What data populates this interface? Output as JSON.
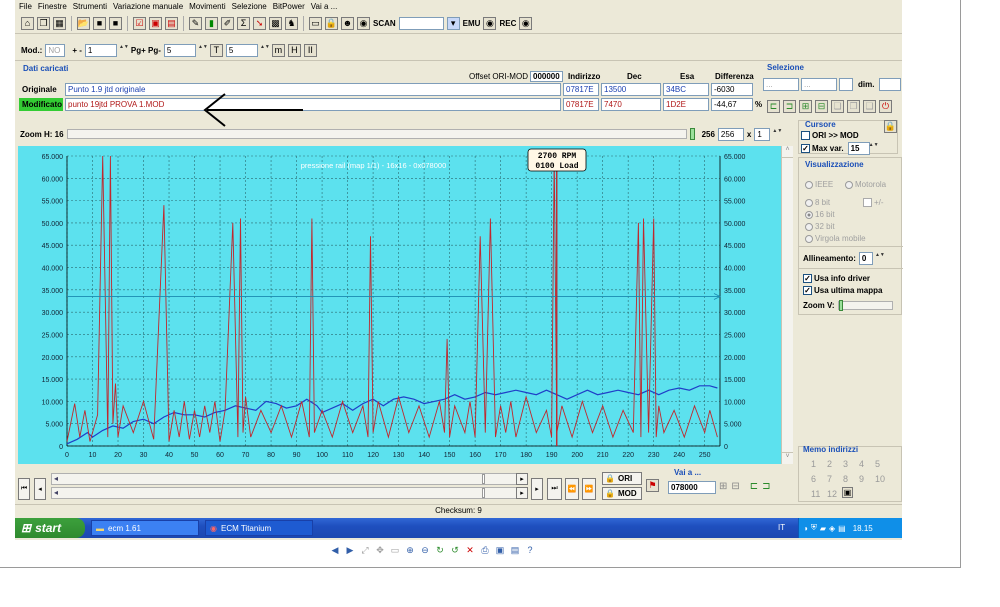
{
  "menu": [
    "File",
    "Finestre",
    "Strumenti",
    "Variazione manuale",
    "Movimenti",
    "Selezione",
    "BitPower",
    "Vai a ..."
  ],
  "toolbar1": {
    "scan_label": "SCAN",
    "emu_label": "EMU",
    "rec_label": "REC"
  },
  "toolbar2": {
    "mod_label": "Mod.:",
    "mod_value": "NO",
    "step_label": "+ -",
    "step_value": "1",
    "pg_label": "Pg+ Pg-",
    "pg_value": "5",
    "t_value": "5"
  },
  "dati": {
    "title": "Dati caricati",
    "offset_label": "Offset ORI-MOD",
    "offset_value": "000000",
    "headers": {
      "indirizzo": "Indirizzo",
      "dec": "Dec",
      "esa": "Esa",
      "differenza": "Differenza"
    },
    "originale": {
      "label": "Originale",
      "file": "Punto 1.9 jtd originale",
      "indirizzo": "07817E",
      "dec": "13500",
      "esa": "34BC",
      "diff": "-6030"
    },
    "modificato": {
      "label": "Modificato",
      "file": "punto 19jtd PROVA 1.MOD",
      "indirizzo": "07817E",
      "dec": "7470",
      "esa": "1D2E",
      "diff": "-44,67",
      "diff_unit": "%"
    }
  },
  "selezione": {
    "title": "Selezione",
    "f1": "...",
    "f2": "...",
    "dim_label": "dim."
  },
  "zoom": {
    "label": "Zoom H: 16",
    "v1": "256",
    "v2": "256",
    "mult": "x",
    "v3": "1"
  },
  "cursore": {
    "title": "Cursore",
    "ori_mod": "ORI >> MOD",
    "maxvar_label": "Max var.",
    "maxvar_value": "15"
  },
  "visualizzazione": {
    "title": "Visualizzazione",
    "ieee": "IEEE",
    "motorola": "Motorola",
    "bit8": "8 bit",
    "plusminus": "+/-",
    "bit16": "16 bit",
    "bit32": "32 bit",
    "virgola": "Virgola mobile",
    "allineamento_label": "Allineamento:",
    "allineamento_value": "0",
    "info_driver": "Usa info driver",
    "ultima_mappa": "Usa ultima mappa",
    "zoomv": "Zoom V:"
  },
  "memo": {
    "title": "Memo indirizzi",
    "items": [
      "1",
      "2",
      "3",
      "4",
      "5",
      "6",
      "7",
      "8",
      "9",
      "10",
      "11",
      "12"
    ]
  },
  "chart": {
    "title": "pressione rail (map 1/1) - 16x16 - 0x078000",
    "tooltip1": "2700 RPM",
    "tooltip2": "0100 Load"
  },
  "chart_data": {
    "type": "line",
    "title": "pressione rail (map 1/1) - 16x16 - 0x078000",
    "xlim": [
      0,
      256
    ],
    "ylim": [
      0,
      65000
    ],
    "x_ticks": [
      "0",
      "10",
      "20",
      "30",
      "40",
      "50",
      "60",
      "70",
      "80",
      "90",
      "100",
      "110",
      "120",
      "130",
      "140",
      "150",
      "160",
      "170",
      "180",
      "190",
      "200",
      "210",
      "220",
      "230",
      "240",
      "250"
    ],
    "y_ticks": [
      "0",
      "5.000",
      "10.000",
      "15.000",
      "20.000",
      "25.000",
      "30.000",
      "35.000",
      "40.000",
      "45.000",
      "50.000",
      "55.000",
      "60.000",
      "65.000"
    ],
    "cursor_y": 33500,
    "cursor_x": 192,
    "grid": true,
    "series": [
      {
        "color": "#1f3fc8",
        "x": [
          0,
          4,
          8,
          10,
          14,
          18,
          22,
          26,
          30,
          34,
          38,
          42,
          46,
          50,
          54,
          58,
          62,
          66,
          70,
          74,
          78,
          82,
          86,
          90,
          94,
          98,
          100,
          104,
          108,
          112,
          116,
          120,
          124,
          128,
          132,
          136,
          140,
          144,
          148,
          152,
          156,
          160,
          164,
          168,
          172,
          176,
          180,
          184,
          188,
          192,
          196,
          200,
          204,
          208,
          212,
          216,
          220,
          224,
          228,
          232,
          236,
          240,
          244,
          248,
          252,
          255
        ],
        "y": [
          500,
          1500,
          3000,
          2000,
          3500,
          4500,
          4000,
          5500,
          6000,
          5000,
          6500,
          7500,
          7000,
          7000,
          6500,
          7500,
          8000,
          9000,
          8500,
          8000,
          10000,
          9500,
          8500,
          9000,
          10500,
          9000,
          7500,
          8500,
          9500,
          8000,
          9500,
          10500,
          9000,
          10500,
          11000,
          10500,
          9500,
          10000,
          10500,
          11500,
          10500,
          11000,
          12000,
          11500,
          12000,
          12500,
          12000,
          11500,
          12500,
          11500,
          10500,
          11500,
          12500,
          11500,
          12000,
          12500,
          12000,
          11500,
          12500,
          11500,
          12500,
          13000,
          12500,
          13500,
          13500,
          13000
        ]
      },
      {
        "color": "#c0282d",
        "x": [
          0,
          3,
          5,
          7,
          9,
          12,
          14,
          16,
          17,
          18,
          19,
          20,
          22,
          26,
          30,
          34,
          38,
          40,
          42,
          44,
          46,
          48,
          50,
          52,
          54,
          56,
          58,
          60,
          62,
          65,
          67,
          68,
          69,
          70,
          72,
          76,
          80,
          84,
          88,
          92,
          95,
          96,
          97,
          100,
          104,
          108,
          112,
          116,
          118,
          119,
          120,
          122,
          126,
          130,
          134,
          138,
          142,
          146,
          148,
          149,
          150,
          152,
          156,
          158,
          160,
          162,
          164,
          166,
          168,
          170,
          172,
          174,
          176,
          180,
          184,
          188,
          190,
          191,
          192,
          194,
          198,
          202,
          206,
          210,
          214,
          218,
          222,
          224,
          225,
          226,
          228,
          230,
          231,
          232,
          234,
          238,
          242,
          246,
          250,
          252,
          255
        ],
        "y": [
          1000,
          9500,
          2000,
          8000,
          1000,
          7000,
          65000,
          2000,
          65000,
          5000,
          14000,
          2000,
          9000,
          3000,
          10000,
          1500,
          54000,
          1000,
          8000,
          2000,
          10000,
          1500,
          8000,
          2000,
          9000,
          3000,
          10000,
          1000,
          8000,
          50000,
          2000,
          51000,
          3000,
          11000,
          2000,
          8000,
          3000,
          9000,
          2000,
          10000,
          2000,
          51000,
          3000,
          8000,
          2000,
          10000,
          3000,
          9000,
          2000,
          47000,
          3000,
          10000,
          2000,
          11000,
          3000,
          9000,
          2000,
          10000,
          3000,
          24000,
          2000,
          9000,
          3000,
          10000,
          2000,
          47000,
          3000,
          51000,
          2000,
          9000,
          3000,
          10000,
          2000,
          11000,
          3000,
          8000,
          2000,
          65000,
          3000,
          9000,
          2000,
          10000,
          3000,
          9000,
          2000,
          8000,
          3000,
          50000,
          2000,
          51000,
          3000,
          51000,
          2000,
          9000,
          3000,
          8000,
          2000,
          9000,
          3000,
          8000,
          2000
        ]
      }
    ]
  },
  "bottom": {
    "ori_btn": "ORI",
    "mod_btn": "MOD",
    "vai_label": "Vai a ...",
    "vai_value": "078000",
    "checksum": "Checksum: 9"
  },
  "taskbar": {
    "start": "start",
    "tasks": [
      "ecm 1.61",
      "ECM Titanium"
    ],
    "lang": "IT",
    "time": "18.15"
  },
  "colors": {
    "plot_bg": "#5ce1ee",
    "originale_tag": "#ece9d8",
    "modificato_tag": "#33cc33"
  }
}
